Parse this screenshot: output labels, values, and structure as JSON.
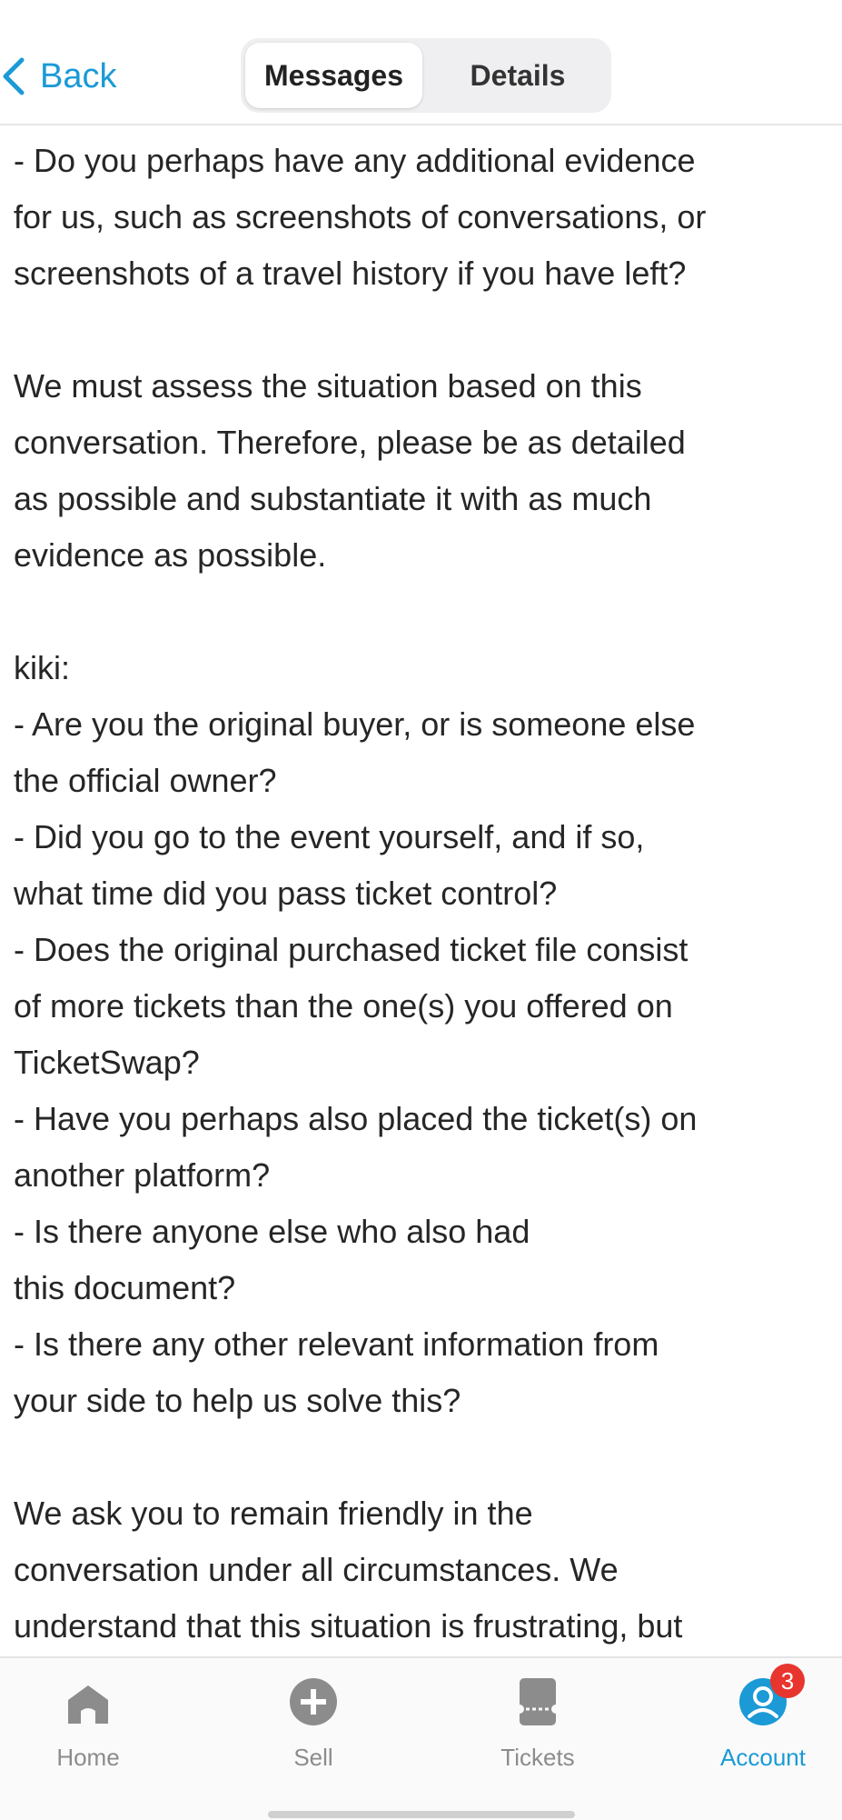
{
  "header": {
    "back_label": "Back",
    "tabs": [
      {
        "label": "Messages",
        "active": true
      },
      {
        "label": "Details",
        "active": false
      }
    ]
  },
  "message": {
    "para1": "- Do you perhaps have any additional evidence\nfor us, such as screenshots of conversations, or\nscreenshots of a travel history if you have left?",
    "para2": "We must assess the situation based on this\nconversation. Therefore, please be as detailed\nas possible and substantiate it with as much\nevidence as possible.",
    "para3": "kiki:\n- Are you the original buyer, or is someone else\nthe official owner?\n- Did you go to the event yourself, and if so,\nwhat time did you pass ticket control?\n- Does the original purchased ticket file consist\nof more tickets than the one(s) you offered on\nTicketSwap?\n- Have you perhaps also placed the ticket(s) on\nanother platform?\n- Is there anyone else who also had\nthis document?\n- Is there any other relevant information from\nyour side to help us solve this?",
    "para4": "We ask you to remain friendly in the\nconversation under all circumstances. We\nunderstand that this situation is frustrating, but"
  },
  "tabbar": {
    "items": [
      {
        "label": "Home",
        "icon": "home-icon"
      },
      {
        "label": "Sell",
        "icon": "plus-circle-icon"
      },
      {
        "label": "Tickets",
        "icon": "ticket-icon"
      },
      {
        "label": "Account",
        "icon": "user-icon",
        "badge": "3"
      }
    ]
  },
  "colors": {
    "accent": "#1b9ad6",
    "badge": "#e8352d",
    "inactive_icon": "#8c8c8c"
  }
}
